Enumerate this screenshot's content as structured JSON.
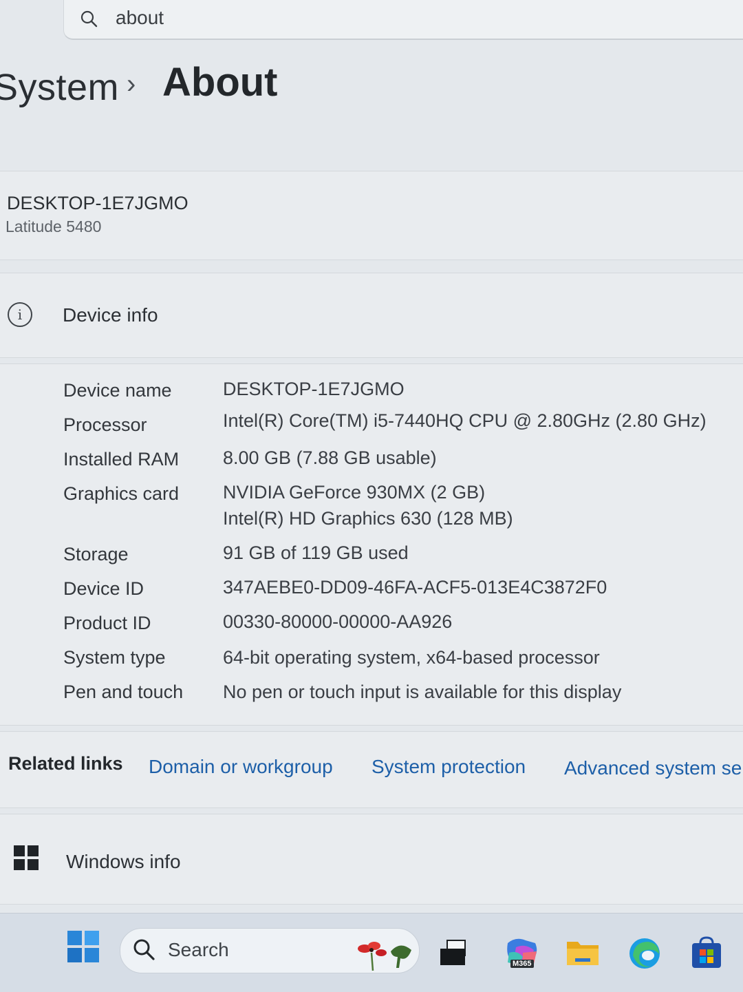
{
  "search": {
    "query": "about"
  },
  "breadcrumb": {
    "parent": "System",
    "separator": "›",
    "current": "About"
  },
  "device_header": {
    "name": "DESKTOP-1E7JGMO",
    "model": "Latitude 5480"
  },
  "device_info": {
    "title": "Device info",
    "specs": [
      {
        "label": "Device name",
        "value": "DESKTOP-1E7JGMO",
        "value2": ""
      },
      {
        "label": "Processor",
        "value": "Intel(R) Core(TM) i5-7440HQ CPU @ 2.80GHz (2.80 GHz)",
        "value2": ""
      },
      {
        "label": "Installed RAM",
        "value": "8.00 GB (7.88 GB usable)",
        "value2": ""
      },
      {
        "label": "Graphics card",
        "value": "NVIDIA GeForce 930MX (2 GB)",
        "value2": "Intel(R) HD Graphics 630 (128 MB)"
      },
      {
        "label": "Storage",
        "value": "91 GB of 119 GB used",
        "value2": ""
      },
      {
        "label": "Device ID",
        "value": "347AEBE0-DD09-46FA-ACF5-013E4C3872F0",
        "value2": ""
      },
      {
        "label": "Product ID",
        "value": "00330-80000-00000-AA926",
        "value2": ""
      },
      {
        "label": "System type",
        "value": "64-bit operating system, x64-based processor",
        "value2": ""
      },
      {
        "label": "Pen and touch",
        "value": "No pen or touch input is available for this display",
        "value2": ""
      }
    ]
  },
  "related_links": {
    "title": "Related links",
    "links": [
      "Domain or workgroup",
      "System protection",
      "Advanced system se"
    ]
  },
  "windows_info": {
    "title": "Windows info"
  },
  "taskbar": {
    "search_label": "Search",
    "apps": [
      "task-view-icon",
      "m365-icon",
      "file-explorer-icon",
      "edge-icon",
      "store-icon"
    ],
    "m365_badge": "M365"
  },
  "colors": {
    "link": "#1d5fa8",
    "background": "#e4e8ec",
    "taskbar": "#d6dde6"
  }
}
